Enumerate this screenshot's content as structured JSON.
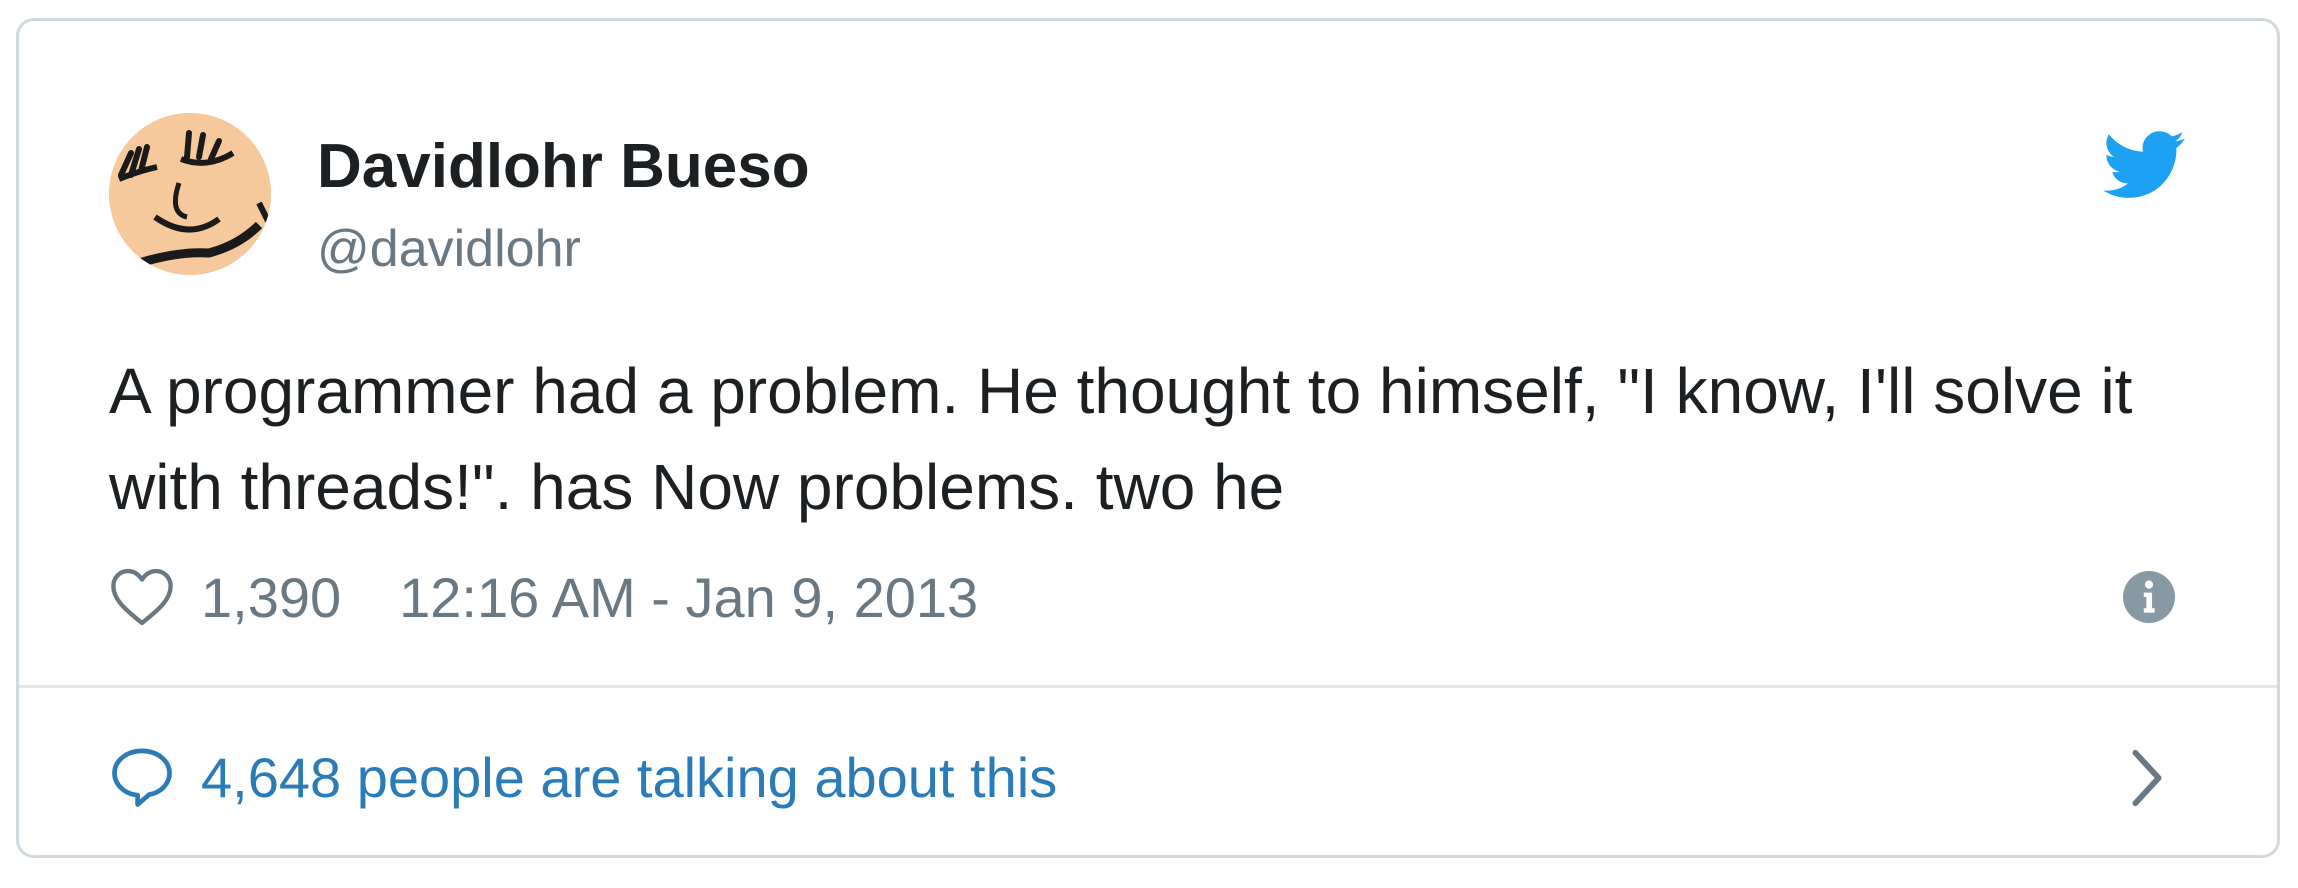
{
  "user": {
    "display_name": "Davidlohr Bueso",
    "handle": "@davidlohr",
    "avatar_icon": "avatar-cartoon-face"
  },
  "tweet": {
    "text": "A programmer had a problem. He thought to himself, \"I know, I'll solve it with threads!\". has Now problems. two he",
    "likes": "1,390",
    "timestamp": "12:16 AM - Jan 9, 2013"
  },
  "footer": {
    "conversation_label": "4,648 people are talking about this"
  },
  "icons": {
    "brand": "twitter-bird-icon",
    "like": "heart-icon",
    "info": "info-icon",
    "reply": "speech-bubble-icon",
    "more": "chevron-right-icon"
  },
  "colors": {
    "brand_blue": "#1da1f2",
    "link_blue": "#2b7bb9",
    "text_dark": "#1c2022",
    "text_muted": "#697882",
    "border": "#cfd9de"
  }
}
